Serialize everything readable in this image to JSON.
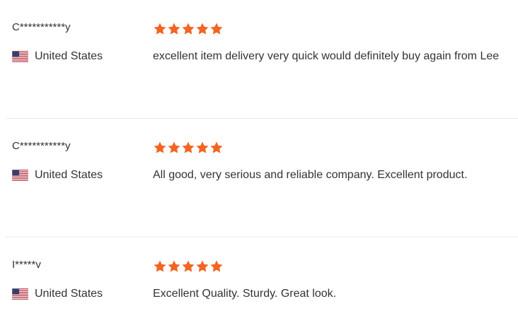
{
  "colors": {
    "star": "#f26522",
    "text": "#333333",
    "divider": "#ececec"
  },
  "reviews": [
    {
      "name": "C***********y",
      "country": "United States",
      "flag_icon": "us-flag-icon",
      "rating": 5,
      "comment": "excellent item delivery very quick would definitely buy again from Lee"
    },
    {
      "name": "C***********y",
      "country": "United States",
      "flag_icon": "us-flag-icon",
      "rating": 5,
      "comment": "All good, very serious and reliable company. Excellent product."
    },
    {
      "name": "I*****v",
      "country": "United States",
      "flag_icon": "us-flag-icon",
      "rating": 5,
      "comment": "Excellent Quality. Sturdy. Great look."
    }
  ]
}
